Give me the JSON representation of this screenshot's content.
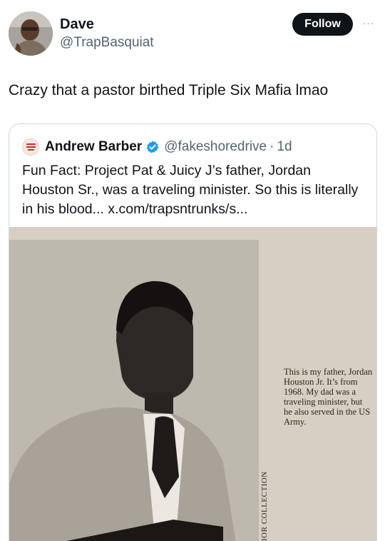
{
  "post": {
    "author": {
      "name": "Dave",
      "handle": "@TrapBasquiat"
    },
    "follow_label": "Follow",
    "more_label": "···",
    "text": "Crazy that a pastor birthed Triple Six Mafia lmao"
  },
  "quote": {
    "author": {
      "name": "Andrew Barber",
      "handle": "@fakeshoredrive",
      "separator": "·",
      "time": "1d"
    },
    "text": "Fun Fact: Project Pat & Juicy J’s father, Jordan Houston Sr., was a traveling minister. So this is literally in his blood... x.com/trapsntrunks/s...",
    "image": {
      "caption": "This is my father, Jordan Houston Jr. It’s from 1968. My dad was a traveling minister, but he also served in the US Army.",
      "vertical_credit": "IOR COLLECTION"
    }
  },
  "colors": {
    "accent": "#1d9bf0",
    "text": "#0f1419",
    "muted": "#536471",
    "border": "#cfd9de"
  }
}
